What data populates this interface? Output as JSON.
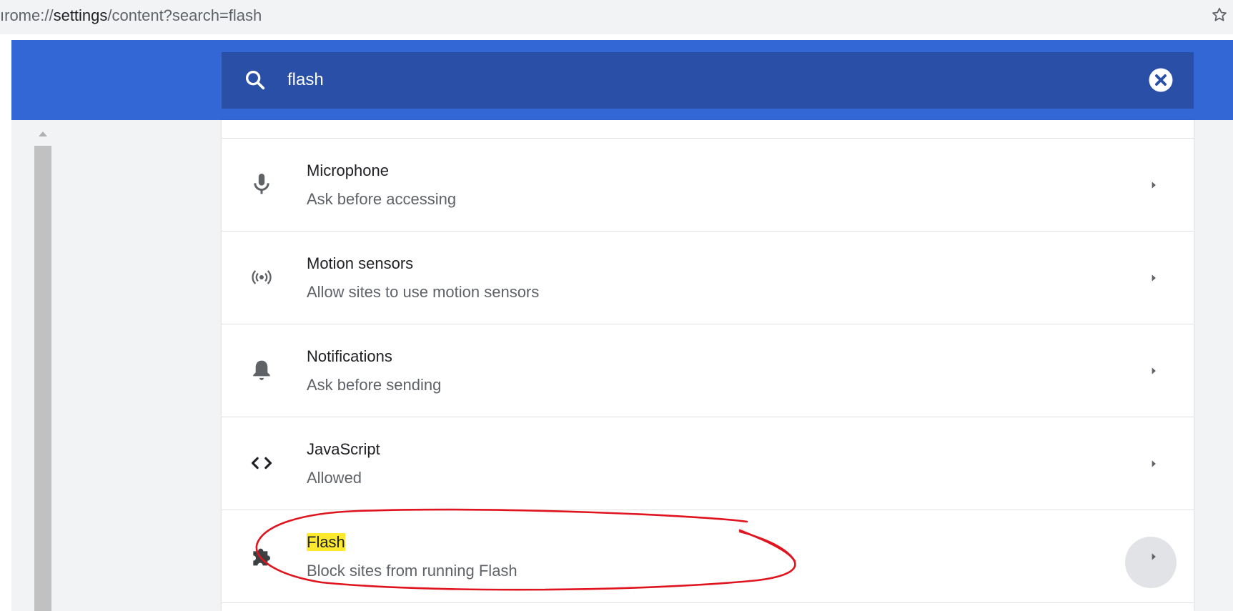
{
  "address_bar": {
    "url_prefix": "ırome://",
    "url_emph": "settings",
    "url_suffix": "/content?search=flash"
  },
  "search": {
    "value": "flash",
    "icon": "search-icon",
    "clear_icon": "clear-circle-icon"
  },
  "rows": [
    {
      "title": "Microphone",
      "subtitle": "Ask before accessing",
      "icon": "microphone-icon"
    },
    {
      "title": "Motion sensors",
      "subtitle": "Allow sites to use motion sensors",
      "icon": "motion-sensors-icon"
    },
    {
      "title": "Notifications",
      "subtitle": "Ask before sending",
      "icon": "bell-icon"
    },
    {
      "title": "JavaScript",
      "subtitle": "Allowed",
      "icon": "code-brackets-icon"
    },
    {
      "title": "Flash",
      "subtitle": "Block sites from running Flash",
      "icon": "puzzle-piece-icon",
      "highlighted": true
    }
  ],
  "colors": {
    "header_blue": "#3367d6",
    "search_box_blue": "#2a4fa6",
    "highlight_yellow": "#ffe92e",
    "annotation_red": "#e0141e"
  }
}
